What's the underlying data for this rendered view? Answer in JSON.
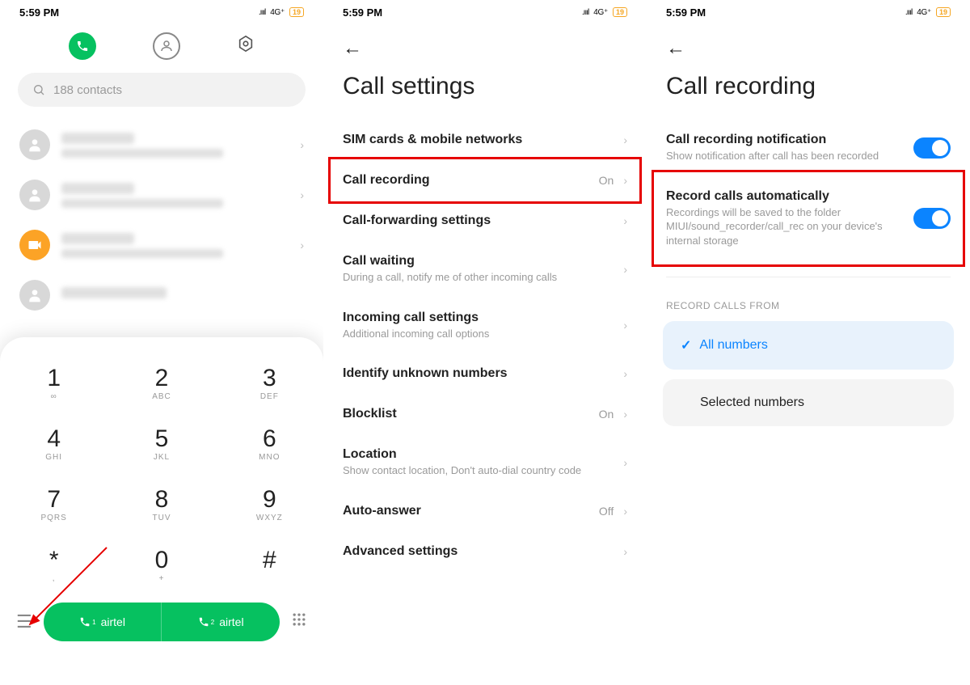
{
  "statusbar": {
    "time": "5:59 PM",
    "network": "4G",
    "battery": "19"
  },
  "screen1": {
    "search_placeholder": "188 contacts",
    "keypad": [
      {
        "num": "1",
        "sub": "∞"
      },
      {
        "num": "2",
        "sub": "ABC"
      },
      {
        "num": "3",
        "sub": "DEF"
      },
      {
        "num": "4",
        "sub": "GHI"
      },
      {
        "num": "5",
        "sub": "JKL"
      },
      {
        "num": "6",
        "sub": "MNO"
      },
      {
        "num": "7",
        "sub": "PQRS"
      },
      {
        "num": "8",
        "sub": "TUV"
      },
      {
        "num": "9",
        "sub": "WXYZ"
      },
      {
        "num": "*",
        "sub": ","
      },
      {
        "num": "0",
        "sub": "+"
      },
      {
        "num": "#",
        "sub": ""
      }
    ],
    "sim1_label": "airtel",
    "sim2_label": "airtel"
  },
  "screen2": {
    "title": "Call settings",
    "rows": {
      "sim": {
        "title": "SIM cards & mobile networks"
      },
      "rec": {
        "title": "Call recording",
        "value": "On"
      },
      "fwd": {
        "title": "Call-forwarding settings"
      },
      "wait": {
        "title": "Call waiting",
        "desc": "During a call, notify me of other incoming calls"
      },
      "inc": {
        "title": "Incoming call settings",
        "desc": "Additional incoming call options"
      },
      "unk": {
        "title": "Identify unknown numbers"
      },
      "blk": {
        "title": "Blocklist",
        "value": "On"
      },
      "loc": {
        "title": "Location",
        "desc": "Show contact location, Don't auto-dial country code"
      },
      "auto": {
        "title": "Auto-answer",
        "value": "Off"
      },
      "adv": {
        "title": "Advanced settings"
      }
    }
  },
  "screen3": {
    "title": "Call recording",
    "notif": {
      "title": "Call recording notification",
      "desc": "Show notification after call has been recorded"
    },
    "auto": {
      "title": "Record calls automatically",
      "desc": "Recordings will be saved to the folder MIUI/sound_recorder/call_rec on your device's internal storage"
    },
    "section_label": "RECORD CALLS FROM",
    "opt_all": "All numbers",
    "opt_sel": "Selected numbers"
  }
}
